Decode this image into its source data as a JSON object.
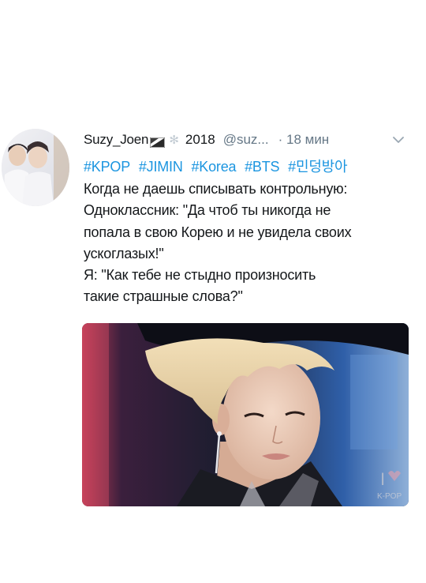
{
  "tweet": {
    "author": {
      "display_name": "Suzy_Joen",
      "year": "2018",
      "handle": "@suz...",
      "time": "· 18 мин"
    },
    "hashtags": [
      "#KPOP",
      "#JIMIN",
      "#Korea",
      "#BTS",
      "#민덩방아"
    ],
    "lines": [
      "Когда не даешь списывать контрольную:",
      "Одноклассник: \"Да чтоб ты никогда не",
      "попала в свою Корею и не увидела своих",
      "ускоглазых!\"",
      "Я: \"Как тебе не стыдно  произносить",
      "такие страшные слова?\""
    ],
    "media": {
      "watermark": "K-POP",
      "icons": [
        "flag-icon",
        "gear-icon",
        "chevron-down-icon"
      ]
    }
  },
  "colors": {
    "link": "#1b95e0",
    "text": "#14171a",
    "muted": "#657786",
    "background": "#ffffff"
  }
}
